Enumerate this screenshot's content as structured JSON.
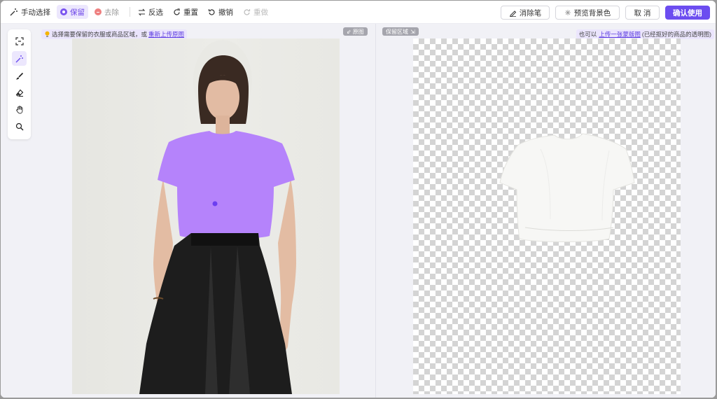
{
  "toolbar": {
    "manual_select": "手动选择",
    "keep": "保留",
    "remove": "去除",
    "invert": "反选",
    "reset": "重置",
    "undo": "撤销",
    "redo": "重做",
    "eraser": "消除笔",
    "preview_bg": "预览背景色",
    "cancel": "取 消",
    "confirm": "确认使用"
  },
  "tools": [
    "box-select-icon",
    "magic-wand-icon",
    "brush-icon",
    "eraser-icon",
    "hand-icon",
    "zoom-icon"
  ],
  "left": {
    "hint_text": "选择需要保留的衣服或商品区域，或",
    "hint_link": "重新上传原图",
    "tag": "原图"
  },
  "right": {
    "tag": "保留区域",
    "hint_pre": "也可以",
    "hint_link": "上传一张蒙版图",
    "hint_post": "(已经抠好的商品的透明图)"
  },
  "help": "?",
  "colors": {
    "accent": "#6c4df0",
    "selection": "#b583fb",
    "keep_dot": "#7b55f0",
    "remove_dot": "#ee8080"
  }
}
